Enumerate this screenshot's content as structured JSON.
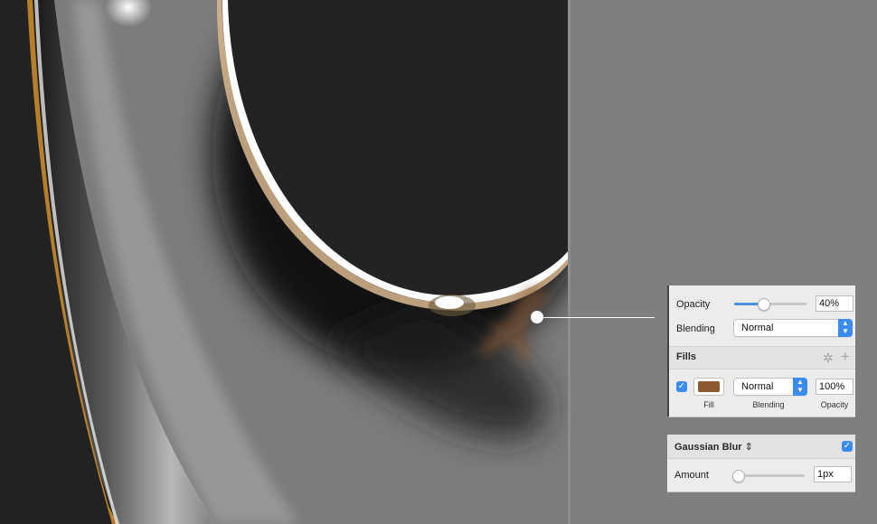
{
  "colors": {
    "accent": "#3b8cf2",
    "slider_fill": "#4a90e2",
    "fill_swatch": "#8a5a35",
    "canvas_dark": "#232323",
    "canvas_gray": "#7e7e7e"
  },
  "appearance": {
    "opacity_label": "Opacity",
    "opacity_value": "40%",
    "opacity_fraction": 0.4,
    "blending_label": "Blending",
    "blending_value": "Normal"
  },
  "fills": {
    "title": "Fills",
    "settings_icon": "gear-icon",
    "add_icon": "plus-icon",
    "items": [
      {
        "enabled": true,
        "color": "#8a5a35",
        "blending": "Normal",
        "opacity": "100%",
        "fill_caption": "Fill",
        "blending_caption": "Blending",
        "opacity_caption": "Opacity"
      }
    ]
  },
  "gaussian_blur": {
    "title": "Gaussian Blur",
    "enabled": true,
    "amount_label": "Amount",
    "amount_value": "1px",
    "amount_fraction": 0.02
  },
  "icons": {
    "checkmark": "✓",
    "stepper_up": "▲",
    "stepper_down": "▼",
    "gear": "✲",
    "plus": "+",
    "updown": "⇕"
  }
}
